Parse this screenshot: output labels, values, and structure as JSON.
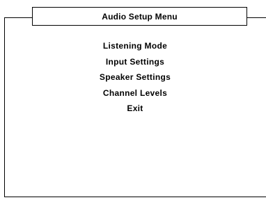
{
  "title": "Audio Setup Menu",
  "menu": {
    "items": [
      {
        "label": "Listening Mode"
      },
      {
        "label": "Input Settings"
      },
      {
        "label": "Speaker Settings"
      },
      {
        "label": "Channel Levels"
      },
      {
        "label": "Exit"
      }
    ]
  }
}
